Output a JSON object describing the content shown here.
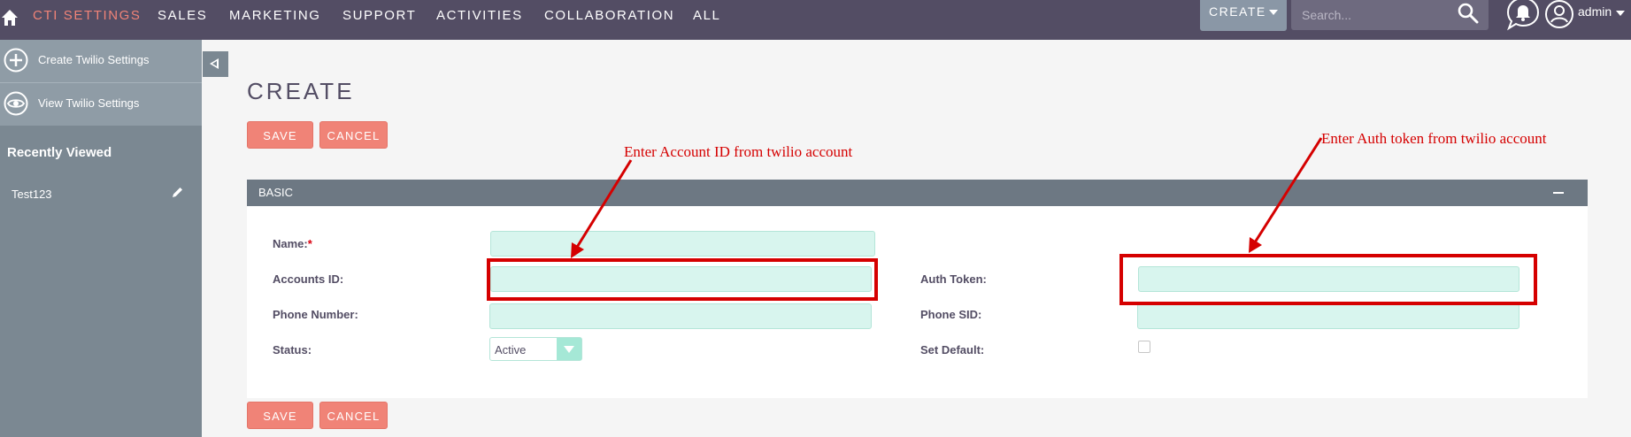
{
  "topnav": {
    "items": [
      {
        "label": "CTI SETTINGS",
        "active": true
      },
      {
        "label": "SALES"
      },
      {
        "label": "MARKETING"
      },
      {
        "label": "SUPPORT"
      },
      {
        "label": "ACTIVITIES"
      },
      {
        "label": "COLLABORATION"
      },
      {
        "label": "ALL"
      }
    ],
    "create_label": "CREATE",
    "search_placeholder": "Search...",
    "user": "admin"
  },
  "sidebar": {
    "actions": [
      {
        "label": "Create Twilio Settings",
        "icon": "plus-circle-icon"
      },
      {
        "label": "View Twilio Settings",
        "icon": "eye-icon"
      }
    ],
    "recent_title": "Recently Viewed",
    "recent_items": [
      {
        "label": "Test123"
      }
    ]
  },
  "main": {
    "title": "CREATE",
    "save_label": "SAVE",
    "cancel_label": "CANCEL",
    "panel_title": "BASIC",
    "fields": {
      "name_label": "Name:",
      "required_mark": "*",
      "accounts_id_label": "Accounts ID:",
      "phone_number_label": "Phone Number:",
      "status_label": "Status:",
      "status_value": "Active",
      "auth_token_label": "Auth Token:",
      "phone_sid_label": "Phone SID:",
      "set_default_label": "Set Default:"
    }
  },
  "annotations": {
    "account_id_note": "Enter Account ID from twilio account",
    "auth_token_note": "Enter Auth token from twilio account"
  },
  "colors": {
    "nav_bg": "#534d64",
    "accent": "#f08377",
    "sidebar_bg": "#7b8892",
    "panel_header_bg": "#6d7883",
    "input_bg": "#d8f5ee",
    "annotation_red": "#d50000"
  }
}
